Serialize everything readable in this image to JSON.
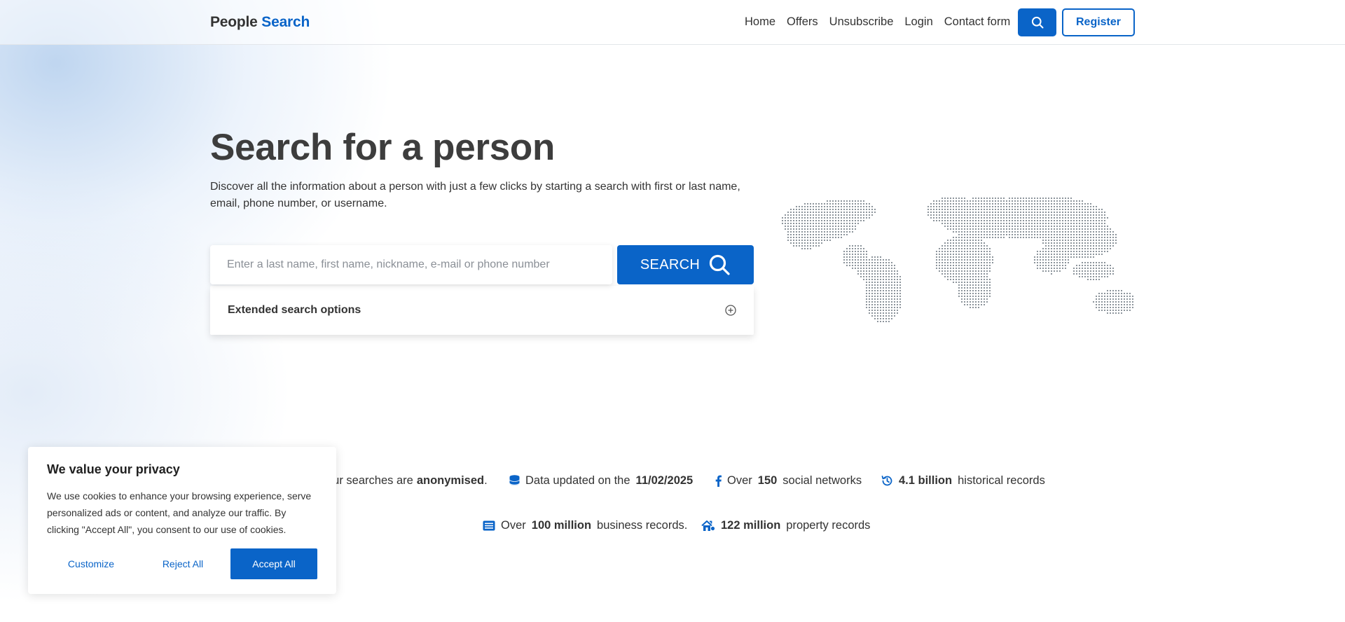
{
  "header": {
    "logo_part1": "People",
    "logo_part2": "Search",
    "nav": [
      "Home",
      "Offers",
      "Unsubscribe",
      "Login",
      "Contact form"
    ],
    "register_label": "Register"
  },
  "hero": {
    "title": "Search for a person",
    "subtitle": "Discover all the information about a person with just a few clicks by starting a search with first or last name, email, phone number, or username.",
    "search_placeholder": "Enter a last name, first name, nickname, e-mail or phone number",
    "search_button": "SEARCH",
    "extended_label": "Extended search options"
  },
  "stats": {
    "anon_pre": "our searches are",
    "anon_bold": "anonymised",
    "anon_post": ".",
    "updated_pre": "Data updated on the",
    "updated_bold": "11/02/2025",
    "social_pre": "Over",
    "social_bold": "150",
    "social_post": "social networks",
    "hist_bold": "4.1 billion",
    "hist_post": "historical records",
    "biz_pre": "Over",
    "biz_bold": "100 million",
    "biz_post": "business records.",
    "prop_bold": "122 million",
    "prop_post": "property records"
  },
  "cookie": {
    "title": "We value your privacy",
    "text": "We use cookies to enhance your browsing experience, serve personalized ads or content, and analyze our traffic. By clicking \"Accept All\", you consent to our use of cookies.",
    "customize": "Customize",
    "reject": "Reject All",
    "accept": "Accept All"
  },
  "colors": {
    "accent": "#0a64c8",
    "text": "#333333",
    "title": "#3d3d3d"
  },
  "icons": [
    "search-icon",
    "plus-circle-icon",
    "database-icon",
    "facebook-icon",
    "history-icon",
    "list-icon",
    "house-icon",
    "world-map"
  ]
}
